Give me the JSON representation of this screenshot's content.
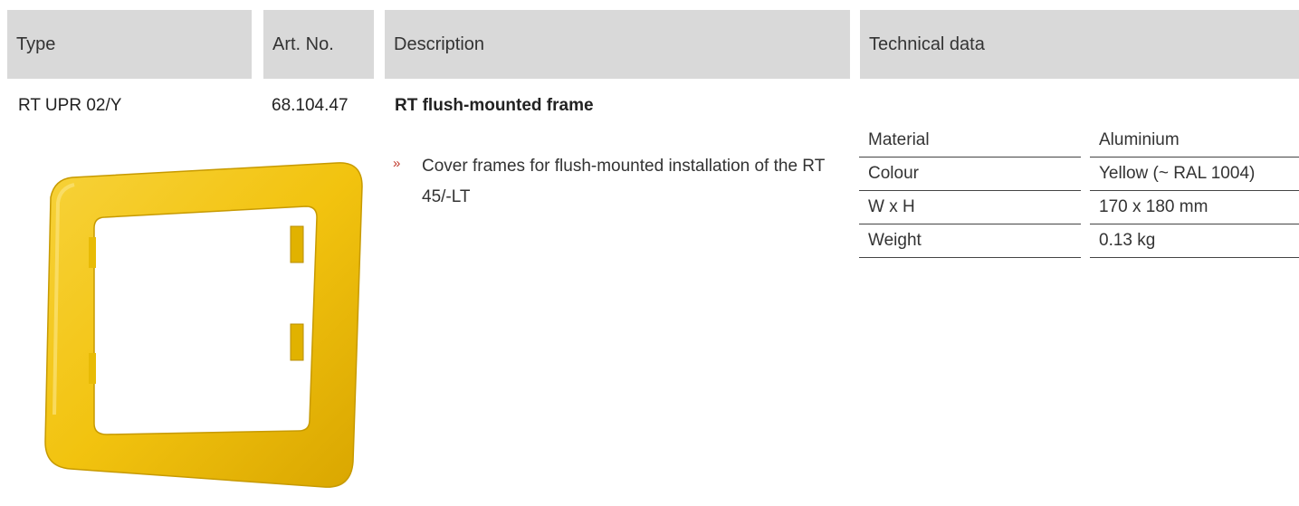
{
  "header": {
    "type": "Type",
    "art_no": "Art. No.",
    "description": "Description",
    "technical_data": "Technical data"
  },
  "product": {
    "type": "RT UPR 02/Y",
    "art_no": "68.104.47",
    "title": "RT flush-mounted frame",
    "bullet_symbol": "»",
    "bullet_text": "Cover frames for flush-mounted installation of the RT 45/-LT",
    "image_icon": "yellow-frame-image",
    "frame_color": "#f2c30f"
  },
  "specs": [
    {
      "label": "Material",
      "value": "Aluminium"
    },
    {
      "label": "Colour",
      "value": "Yellow  (~ RAL 1004)"
    },
    {
      "label": "W x H",
      "value": "170 x 180 mm"
    },
    {
      "label": "Weight",
      "value": "0.13 kg"
    }
  ]
}
